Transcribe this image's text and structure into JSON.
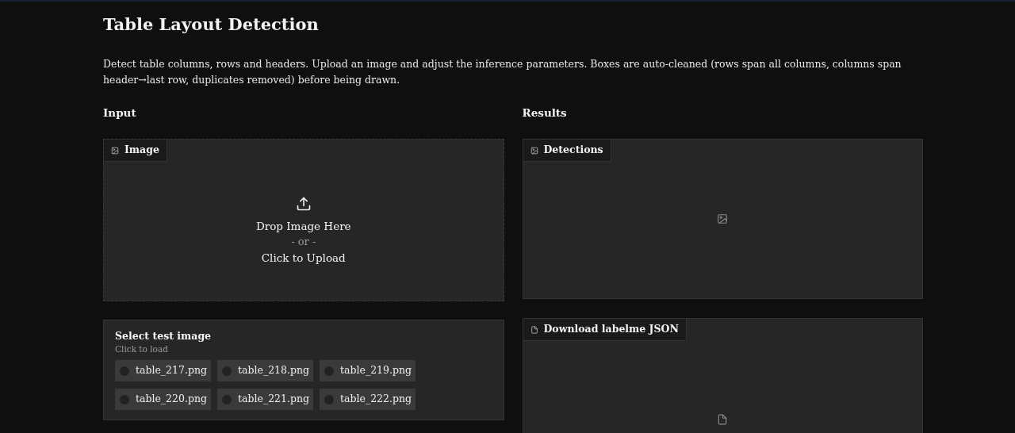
{
  "title": "Table Layout Detection",
  "description": "Detect table columns, rows and headers. Upload an image and adjust the inference parameters. Boxes are auto-cleaned (rows span all columns, columns span header→last row, duplicates removed) before being drawn.",
  "input": {
    "heading": "Input",
    "image": {
      "label": "Image",
      "drop_text": "Drop Image Here",
      "or_text": "- or -",
      "click_text": "Click to Upload"
    },
    "examples": {
      "title": "Select test image",
      "hint": "Click to load",
      "items": [
        {
          "label": "table_217.png",
          "selected": false
        },
        {
          "label": "table_218.png",
          "selected": false
        },
        {
          "label": "table_219.png",
          "selected": false
        },
        {
          "label": "table_220.png",
          "selected": false
        },
        {
          "label": "table_221.png",
          "selected": false
        },
        {
          "label": "table_222.png",
          "selected": false
        }
      ]
    }
  },
  "results": {
    "heading": "Results",
    "detections": {
      "label": "Detections"
    },
    "download": {
      "label": "Download labelme JSON"
    }
  }
}
